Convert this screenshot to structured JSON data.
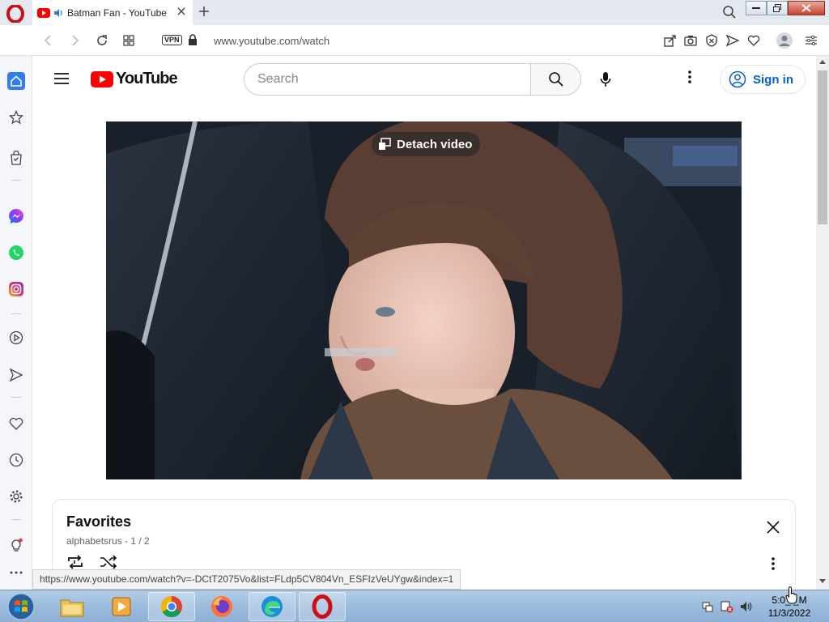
{
  "browser": {
    "tab": {
      "title": "Batman Fan - YouTube"
    },
    "address": {
      "vpn_label": "VPN",
      "url": "www.youtube.com/watch"
    },
    "status_url": "https://www.youtube.com/watch?v=-DCtT2075Vo&list=FLdp5CV804Vn_ESFIzVeUYgw&index=1"
  },
  "youtube": {
    "logo_text": "YouTube",
    "search": {
      "placeholder": "Search",
      "value": ""
    },
    "signin_label": "Sign in",
    "detach_label": "Detach video",
    "playlist": {
      "title": "Favorites",
      "owner_position": "alphabetsrus - 1 / 2"
    }
  },
  "taskbar": {
    "apps": [
      "file-explorer",
      "media-player",
      "chrome",
      "firefox",
      "edge",
      "opera"
    ],
    "clock": {
      "time": "5:0_ _M",
      "date": "11/3/2022"
    }
  },
  "colors": {
    "youtube_red": "#ff0000",
    "link_blue": "#065fd4",
    "opera_red": "#cc0f16",
    "sidebar_accent": "#2f7cf6"
  }
}
